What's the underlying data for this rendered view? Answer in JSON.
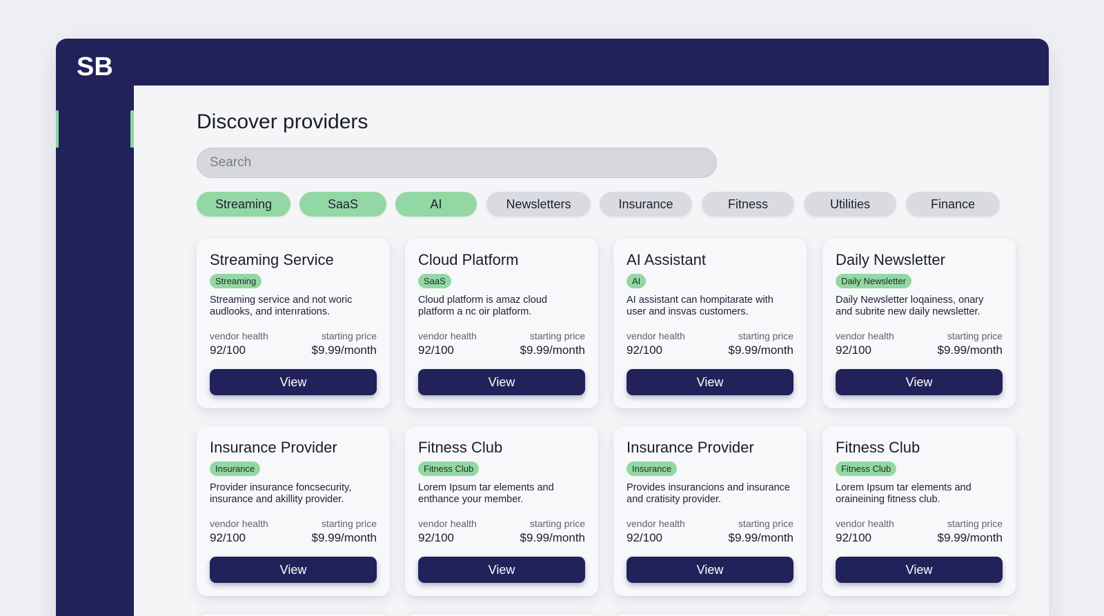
{
  "app": {
    "logo_text": "SB"
  },
  "page": {
    "title": "Discover providers"
  },
  "search": {
    "placeholder": "Search"
  },
  "filters": [
    {
      "label": "Streaming",
      "active": true
    },
    {
      "label": "SaaS",
      "active": true
    },
    {
      "label": "AI",
      "active": true
    },
    {
      "label": "Newsletters",
      "active": false
    },
    {
      "label": "Insurance",
      "active": false
    },
    {
      "label": "Fitness",
      "active": false
    },
    {
      "label": "Utilities",
      "active": false
    },
    {
      "label": "Finance",
      "active": false
    }
  ],
  "card_labels": {
    "health_label": "vendor health",
    "price_label": "starting price",
    "view_label": "View"
  },
  "cards": [
    {
      "title": "Streaming Service",
      "tag": "Streaming",
      "description": "Streaming service and not woric audlooks, and interırations.",
      "health": "92/100",
      "price": "$9.99/month"
    },
    {
      "title": "Cloud Platform",
      "tag": "SaaS",
      "description": "Cloud platform is amaz cloud platform a nc oir platform.",
      "health": "92/100",
      "price": "$9.99/month"
    },
    {
      "title": "AI Assistant",
      "tag": "AI",
      "description": "AI assistant can hompitarate with user and insvas customers.",
      "health": "92/100",
      "price": "$9.99/month"
    },
    {
      "title": "Daily Newsletter",
      "tag": "Daily Newsletter",
      "description": "Daily Newsletter loqainess, onary and subrite new daily newsletter.",
      "health": "92/100",
      "price": "$9.99/month"
    },
    {
      "title": "Insurance Provider",
      "tag": "Insurance",
      "description": "Provider insurance foncsecurity, insurance and akillity provider.",
      "health": "92/100",
      "price": "$9.99/month"
    },
    {
      "title": "Fitness Club",
      "tag": "Fitness Club",
      "description": "Lorem Ipsum tar elements and enthance your member.",
      "health": "92/100",
      "price": "$9.99/month"
    },
    {
      "title": "Insurance Provider",
      "tag": "Insurance",
      "description": "Provides insurancions and insurance and cratisity provider.",
      "health": "92/100",
      "price": "$9.99/month"
    },
    {
      "title": "Fitness Club",
      "tag": "Fitness Club",
      "description": "Lorem Ipsum tar elements and oraineining fitness club.",
      "health": "92/100",
      "price": "$9.99/month"
    }
  ],
  "colors": {
    "navy": "#21225a",
    "accent_green": "#93d8a4",
    "chip_inactive": "#d9dbe0",
    "background": "#eef0f3"
  }
}
